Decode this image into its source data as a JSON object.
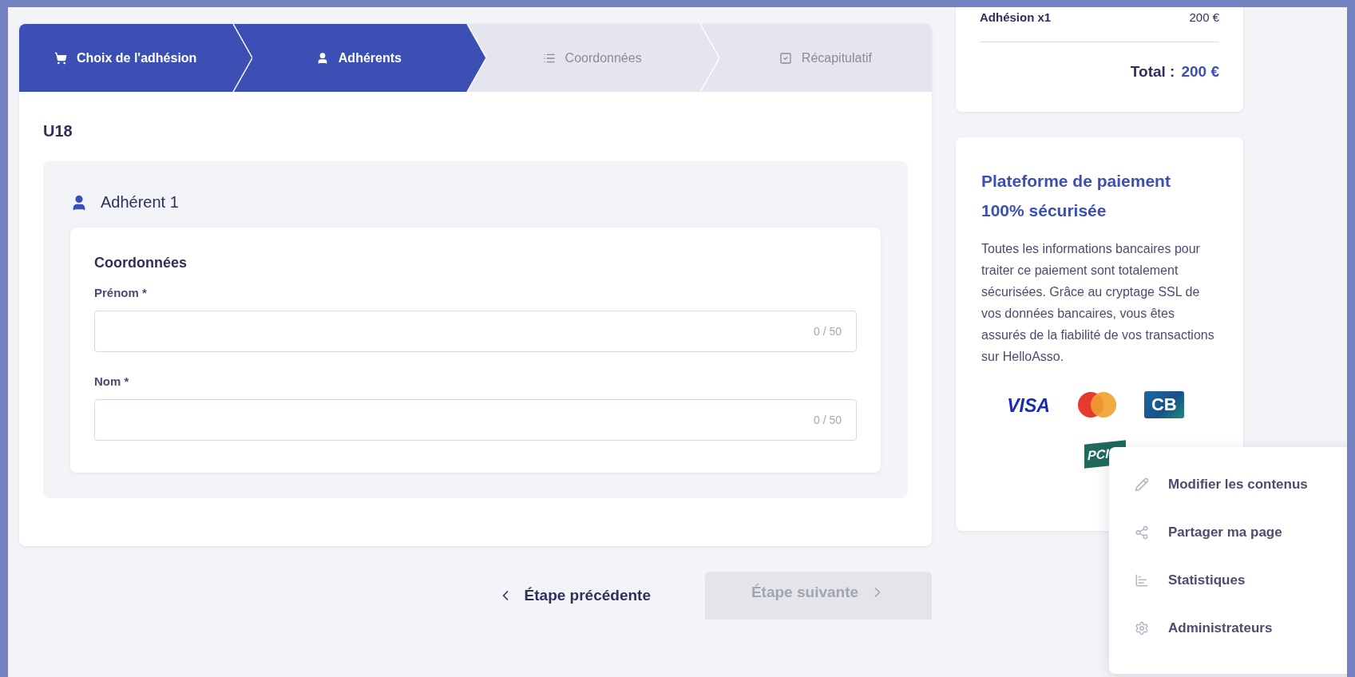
{
  "stepper": [
    {
      "label": "Choix de l'adhésion",
      "active": true
    },
    {
      "label": "Adhérents",
      "active": true
    },
    {
      "label": "Coordonnées",
      "active": false
    },
    {
      "label": "Récapitulatif",
      "active": false
    }
  ],
  "tier": {
    "title": "U18"
  },
  "member": {
    "title": "Adhérent 1",
    "section": "Coordonnées",
    "fields": [
      {
        "label": "Prénom *",
        "counter": "0 / 50"
      },
      {
        "label": "Nom *",
        "counter": "0 / 50"
      }
    ]
  },
  "navigation": {
    "previous": "Étape précédente",
    "next": {
      "label": "Étape suivante",
      "disabled": true
    }
  },
  "summary": {
    "item": "Adhésion x1",
    "item_price": "200 €",
    "total_label": "Total :",
    "total": "200 €"
  },
  "security": {
    "title": "Plateforme de paiement 100% sécurisée",
    "text": "Toutes les informations bancaires pour traiter ce paiement sont totalement sécurisées. Grâce au cryptage SSL de vos données bancaires, vous êtes assurés de la fiabilité de vos transactions sur HelloAsso.",
    "logos": [
      {
        "kind": "visa",
        "text": "VISA"
      },
      {
        "kind": "mastercard"
      },
      {
        "kind": "cb",
        "text": "CB"
      },
      {
        "kind": "pci",
        "text": "PCI"
      }
    ]
  },
  "menu": [
    {
      "label": "Modifier les contenus"
    },
    {
      "label": "Partager ma page"
    },
    {
      "label": "Statistiques"
    },
    {
      "label": "Administrateurs"
    }
  ]
}
